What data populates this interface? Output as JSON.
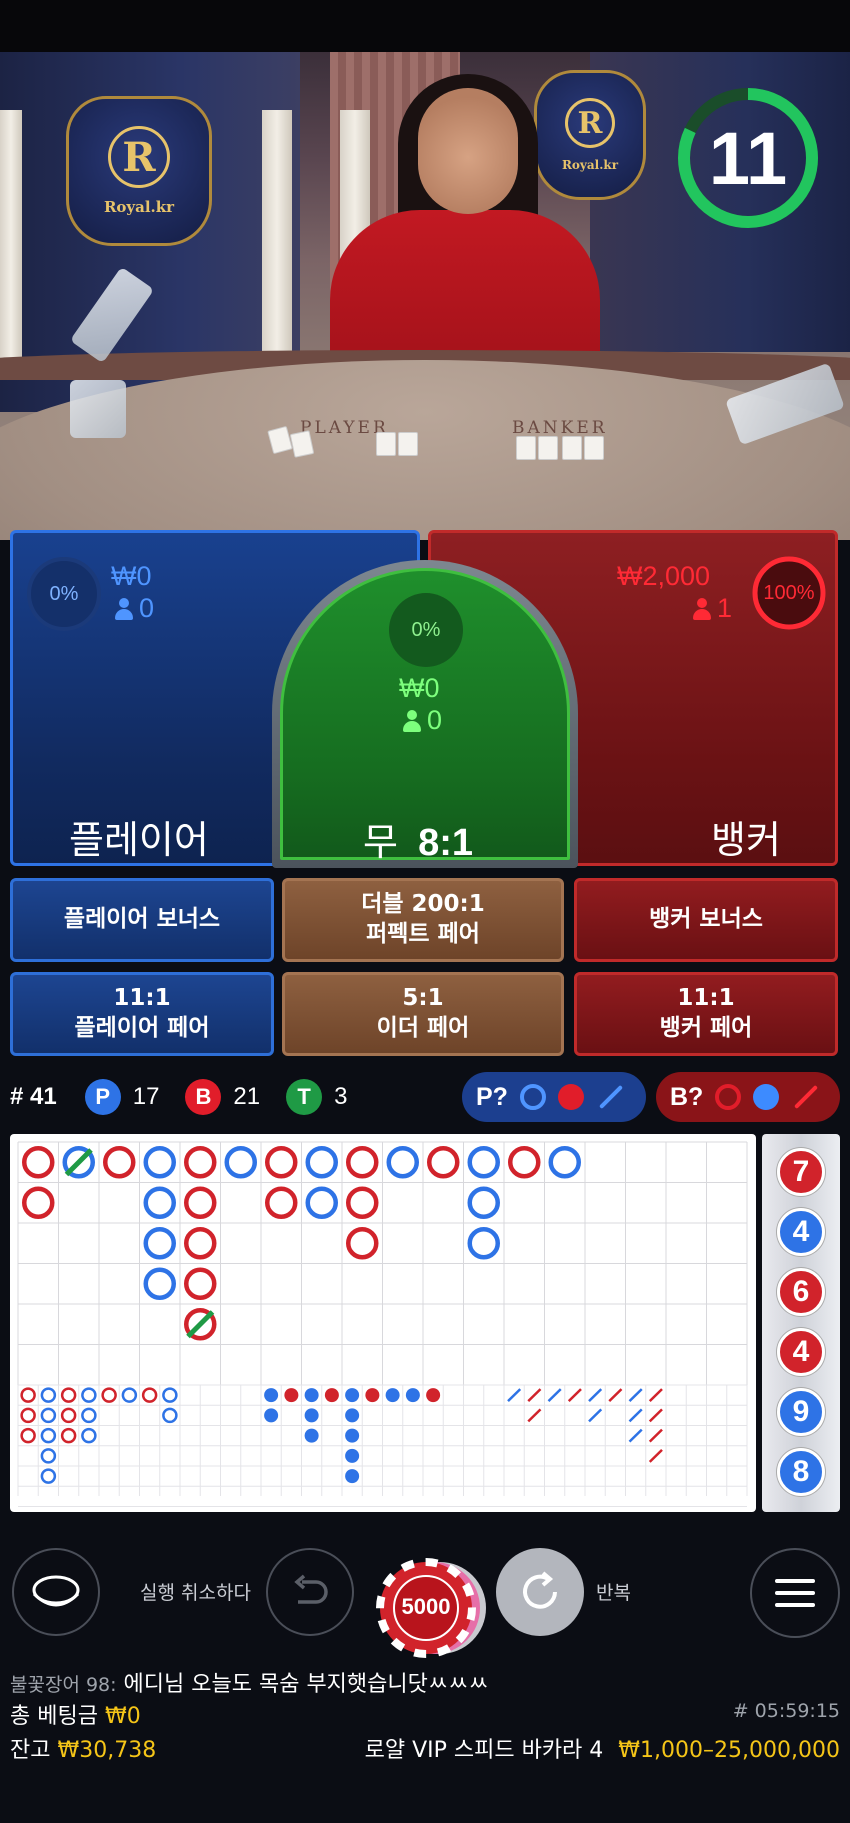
{
  "table": {
    "logo_text": "Royal.kr",
    "logo_letter": "R",
    "felt_player": "PLAYER",
    "felt_banker": "BANKER"
  },
  "timer": {
    "seconds": "11",
    "color": "#22c55e"
  },
  "player": {
    "pct": "0%",
    "amount": "₩0",
    "count": "0",
    "label": "플레이어",
    "color": "#2e73e6"
  },
  "tie": {
    "pct": "0%",
    "amount": "₩0",
    "count": "0",
    "label_main": "무",
    "label_odds": "8:1",
    "color": "#3fbf3f"
  },
  "banker": {
    "pct": "100%",
    "amount": "₩2,000",
    "count": "1",
    "label": "뱅커",
    "color": "#e11d2a"
  },
  "side_bets": {
    "player_bonus": "플레이어 보너스",
    "perfect_pair_odds": "더블 200:1",
    "perfect_pair": "퍼펙트 페어",
    "banker_bonus": "뱅커 보너스",
    "player_pair_odds": "11:1",
    "player_pair": "플레이어 페어",
    "either_pair_odds": "5:1",
    "either_pair": "이더 페어",
    "banker_pair_odds": "11:1",
    "banker_pair": "뱅커 페어"
  },
  "stats": {
    "round": "# 41",
    "p_letter": "P",
    "p_count": "17",
    "b_letter": "B",
    "b_count": "21",
    "t_letter": "T",
    "t_count": "3"
  },
  "predict": {
    "player_label": "P?",
    "banker_label": "B?"
  },
  "bead_road": [
    "7",
    "4",
    "6",
    "4",
    "9",
    "8"
  ],
  "bead_colors": [
    "red",
    "blue",
    "red",
    "red",
    "blue",
    "blue"
  ],
  "controls": {
    "undo_label": "실행 취소하다",
    "chip_value": "5000",
    "repeat_label": "반복"
  },
  "footer": {
    "chat_user": "불꽃장어 98:",
    "chat_message": "에디님 오늘도 목숨 부지햇습니닷ㅆㅆㅆ",
    "total_bet_label": "총 베팅금",
    "total_bet_value": "₩0",
    "game_id": "# 05:59:15",
    "balance_label": "잔고",
    "balance_value": "₩30,738",
    "table_name": "로얄 VIP 스피드 바카라 4",
    "limits": "₩1,000–25,000,000"
  },
  "colors": {
    "accent_gold": "#f5c518",
    "player_blue": "#2e73e6",
    "banker_red": "#e11d2a",
    "tie_green": "#2aa845"
  }
}
